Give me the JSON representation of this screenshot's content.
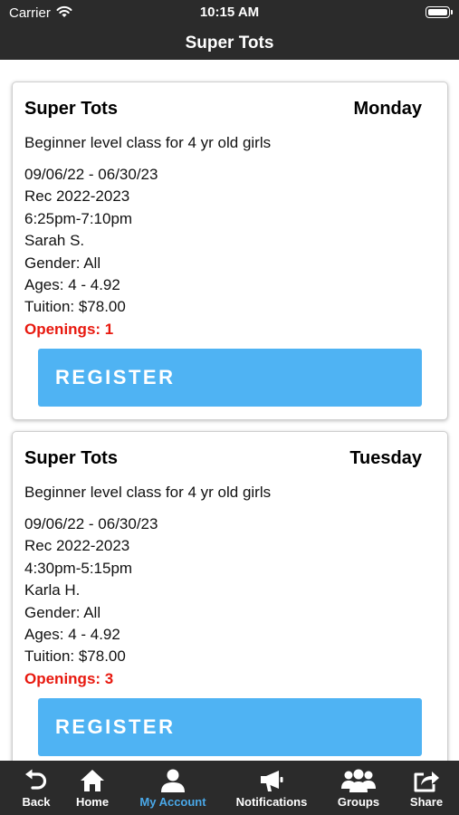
{
  "status_bar": {
    "carrier": "Carrier",
    "time": "10:15 AM"
  },
  "nav": {
    "title": "Super Tots"
  },
  "classes": [
    {
      "name": "Super Tots",
      "day": "Monday",
      "description": "Beginner level class for 4 yr old girls",
      "dates": "09/06/22 - 06/30/23",
      "season": "Rec 2022-2023",
      "time": "6:25pm-7:10pm",
      "instructor": "Sarah S.",
      "gender": "Gender: All",
      "ages": "Ages: 4 - 4.92",
      "tuition": "Tuition: $78.00",
      "openings": "Openings: 1",
      "register_label": "REGISTER"
    },
    {
      "name": "Super Tots",
      "day": "Tuesday",
      "description": "Beginner level class for 4 yr old girls",
      "dates": "09/06/22 - 06/30/23",
      "season": "Rec 2022-2023",
      "time": "4:30pm-5:15pm",
      "instructor": "Karla H.",
      "gender": "Gender: All",
      "ages": "Ages: 4 - 4.92",
      "tuition": "Tuition: $78.00",
      "openings": "Openings: 3",
      "register_label": "REGISTER"
    }
  ],
  "tab_bar": {
    "items": [
      {
        "label": "Back",
        "icon": "back-arrow-icon"
      },
      {
        "label": "Home",
        "icon": "home-icon"
      },
      {
        "label": "My Account",
        "icon": "user-icon",
        "active": true
      },
      {
        "label": "Notifications",
        "icon": "megaphone-icon"
      },
      {
        "label": "Groups",
        "icon": "groups-icon"
      },
      {
        "label": "Share",
        "icon": "share-icon"
      }
    ]
  },
  "colors": {
    "bar_background": "#2b2b2b",
    "register_button": "#4fb3f3",
    "openings_text": "#e8190f",
    "active_tab": "#4aa8e8"
  }
}
